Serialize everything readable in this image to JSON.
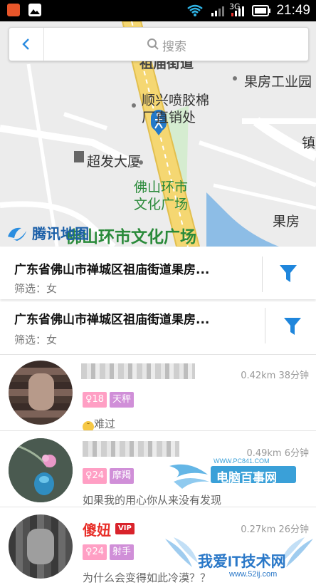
{
  "status_bar": {
    "time": "21:49",
    "network": "3G"
  },
  "map": {
    "labels": [
      {
        "text": "祖庙街道"
      },
      {
        "text": "果房工业园"
      },
      {
        "text": "顺兴喷胶棉"
      },
      {
        "text": "厂直销处"
      },
      {
        "text": "超发大厦"
      },
      {
        "text": "佛山环市"
      },
      {
        "text": "文化广场"
      },
      {
        "text": "果房"
      },
      {
        "text": "佛山环市文化广场"
      },
      {
        "text": "镇"
      }
    ],
    "logo": "腾讯地图"
  },
  "search": {
    "placeholder": "搜索"
  },
  "locations": [
    {
      "address": "广东省佛山市禅城区祖庙街道果房...",
      "filter": "筛选：女"
    },
    {
      "address": "广东省佛山市禅城区祖庙街道果房...",
      "filter": "筛选：女"
    }
  ],
  "people": [
    {
      "name": "",
      "distance": "0.42km 38分钟",
      "age": "18",
      "constellation": "天秤",
      "status": "难过"
    },
    {
      "name": "",
      "distance": "0.49km 6分钟",
      "age": "24",
      "constellation": "摩羯",
      "status": "如果我的用心你从来没有发现"
    },
    {
      "name": "傻妞",
      "vip": "VIP",
      "distance": "0.27km 26分钟",
      "age": "24",
      "constellation": "射手",
      "status": "为什么会变得如此冷漠？？"
    }
  ],
  "watermarks": {
    "pc841_url": "WWW.PC841.COM",
    "pc841_name": "电脑百事网",
    "tech_name": "我爱IT技术网",
    "tech_url": "www.52ij.com"
  }
}
